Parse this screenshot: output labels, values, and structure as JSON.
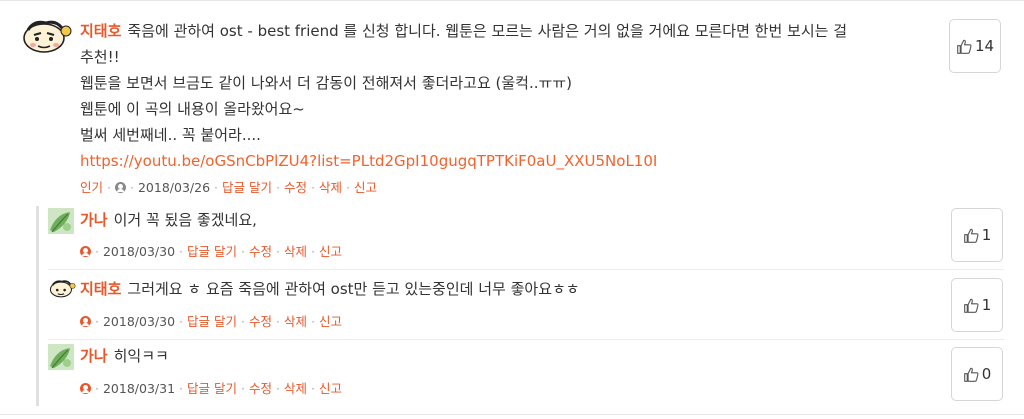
{
  "main_comment": {
    "author": "지태호",
    "lines": [
      "죽음에 관하여 ost - best friend 를 신청 합니다. 웹툰은 모르는 사람은 거의 없을 거에요 모른다면 한번 보시는 걸",
      "추천!!",
      "웹툰을 보면서 브금도 같이 나와서 더 감동이 전해져서 좋더라고요 (울컥..ㅠㅠ)",
      "웹툰에 이 곡의 내용이 올라왔어요~",
      "벌써 세번째네.. 꼭 붙어라...."
    ],
    "link": "https://youtu.be/oGSnCbPlZU4?list=PLtd2GpI10gugqTPTKiF0aU_XXU5NoL10I",
    "tag": "인기",
    "date": "2018/03/26",
    "likes": "14"
  },
  "actions": {
    "reply": "답글 달기",
    "edit": "수정",
    "delete": "삭제",
    "report": "신고"
  },
  "replies": [
    {
      "author": "가나",
      "text": "이거 꼭 됬음 좋겠네요,",
      "date": "2018/03/30",
      "likes": "1"
    },
    {
      "author": "지태호",
      "text": "그러게요 ㅎ 요즘 죽음에 관하여 ost만 듣고 있는중인데 너무 좋아요ㅎㅎ",
      "date": "2018/03/30",
      "likes": "1"
    },
    {
      "author": "가나",
      "text": "히익ㅋㅋ",
      "date": "2018/03/31",
      "likes": "0"
    }
  ],
  "colors": {
    "accent": "#e8582a",
    "link": "#f2622d",
    "text": "#333333"
  },
  "icons": {
    "like": "thumbs-up-icon",
    "user": "user-icon"
  }
}
